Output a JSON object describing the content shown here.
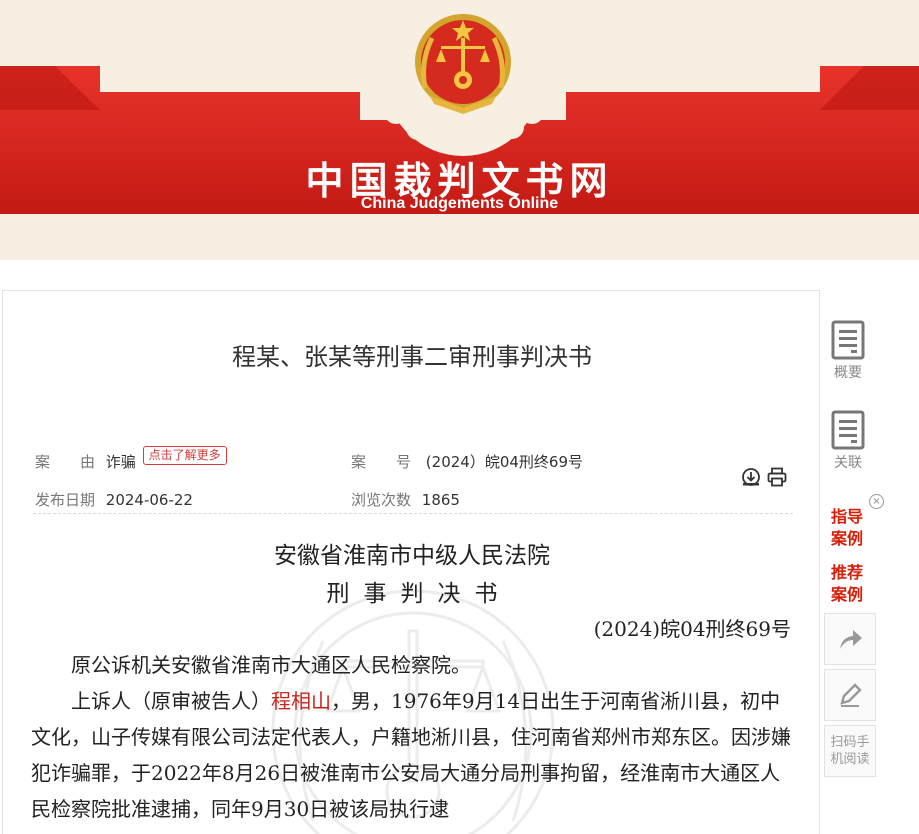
{
  "site": {
    "title": "中国裁判文书网",
    "subtitle": "China Judgements Online"
  },
  "document": {
    "title": "程某、张某等刑事二审刑事判决书",
    "meta": {
      "cause_label": "案　　由",
      "cause_value": "诈骗",
      "cause_more": "点击了解更多",
      "case_no_label": "案　　号",
      "case_no_value": "(2024）皖04刑终69号",
      "publish_label": "发布日期",
      "publish_value": "2024-06-22",
      "views_label": "浏览次数",
      "views_value": "1865"
    },
    "court": "安徽省淮南市中级人民法院",
    "doc_type": "刑事判决书",
    "case_number": "(2024)皖04刑终69号",
    "paragraph1": "原公诉机关安徽省淮南市大通区人民检察院。",
    "p2_prefix": "上诉人（原审被告人）",
    "p2_name": "程相山",
    "p2_rest": "，男，1976年9月14日出生于河南省淅川县，初中文化，山子传媒有限公司法定代表人，户籍地淅川县，住河南省郑州市郑东区。因涉嫌犯诈骗罪，于2022年8月26日被淮南市公安局大通分局刑事拘留，经淮南市大通区人民检察院批准逮捕，同年9月30日被该局执行逮"
  },
  "sidebar": {
    "summary_label": "概要",
    "related_label": "关联",
    "guide_line1": "指导",
    "guide_line2": "案例",
    "recommend_line1": "推荐",
    "recommend_line2": "案例",
    "close_glyph": "×",
    "scan_line1": "扫码手",
    "scan_line2": "机阅读"
  },
  "colors": {
    "banner_red": "#d9251d",
    "accent_red": "#d81e06"
  }
}
